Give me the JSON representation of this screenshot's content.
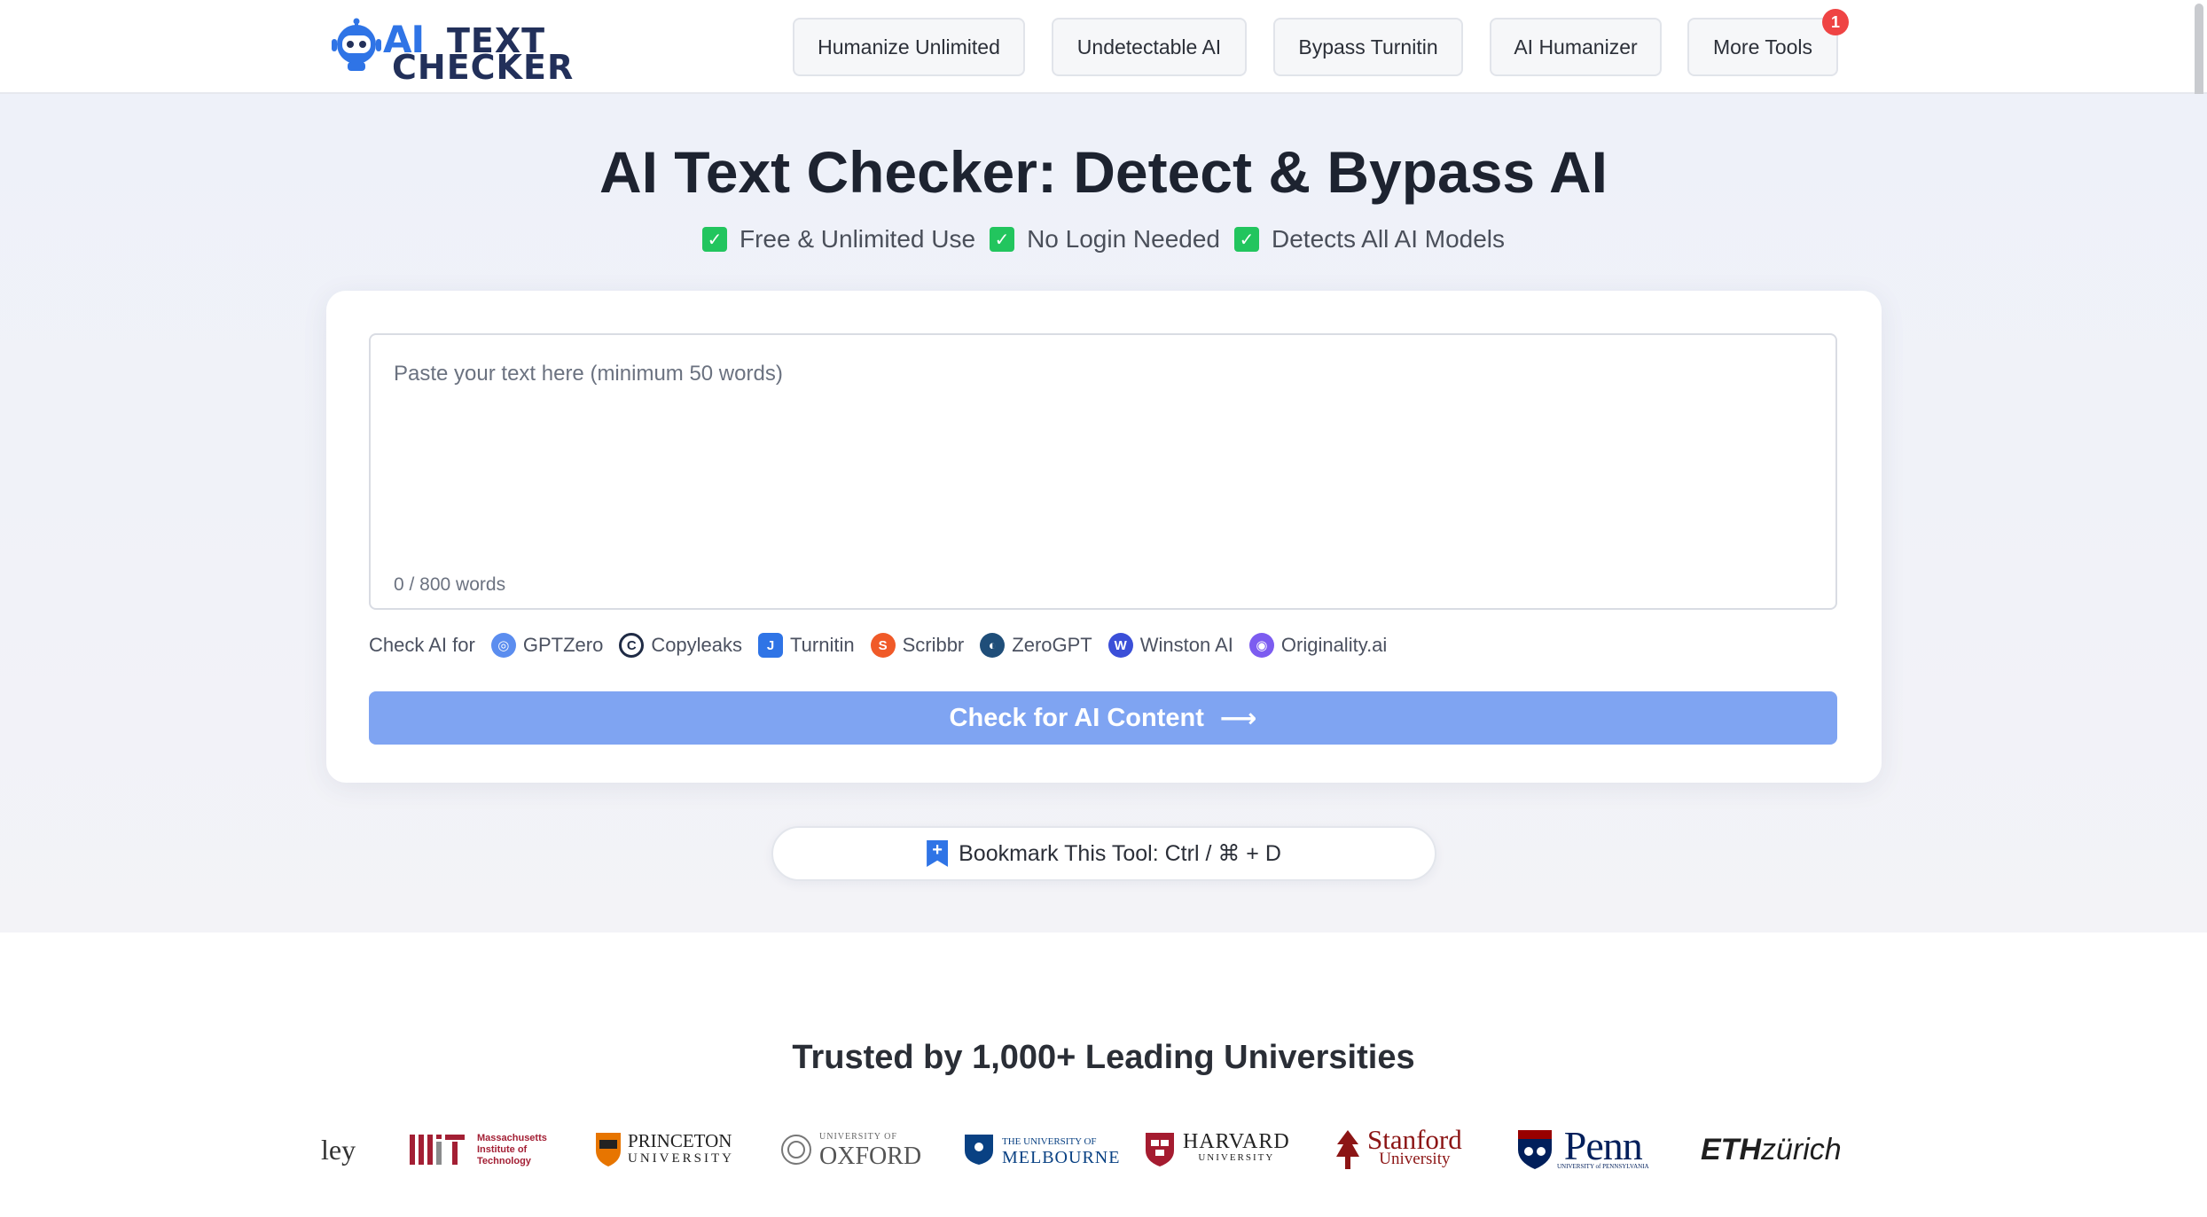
{
  "header": {
    "logo": {
      "line_ai": "AI",
      "line_1": "TEXT",
      "line_2": "CHECKER"
    },
    "nav": [
      {
        "label": "Humanize Unlimited"
      },
      {
        "label": "Undetectable AI"
      },
      {
        "label": "Bypass Turnitin"
      },
      {
        "label": "AI Humanizer"
      },
      {
        "label": "More Tools",
        "badge": "1"
      }
    ]
  },
  "hero": {
    "title": "AI Text Checker: Detect & Bypass AI",
    "features": [
      "Free & Unlimited Use",
      "No Login Needed",
      "Detects All AI Models"
    ]
  },
  "checker": {
    "placeholder": "Paste your text here (minimum 50 words)",
    "word_count": "0 / 800 words",
    "check_for_label": "Check AI for",
    "detectors": [
      {
        "name": "GPTZero",
        "icon": "gptzero-icon",
        "color": "#5b8def"
      },
      {
        "name": "Copyleaks",
        "icon": "copyleaks-icon",
        "color": "#1f2b45"
      },
      {
        "name": "Turnitin",
        "icon": "turnitin-icon",
        "color": "#2f74e6"
      },
      {
        "name": "Scribbr",
        "icon": "scribbr-icon",
        "color": "#f05a28"
      },
      {
        "name": "ZeroGPT",
        "icon": "zerogpt-icon",
        "color": "#1f4e79"
      },
      {
        "name": "Winston AI",
        "icon": "winston-icon",
        "color": "#3b4fd8"
      },
      {
        "name": "Originality.ai",
        "icon": "originality-icon",
        "color": "#7c5cf0"
      }
    ],
    "submit_label": "Check for AI Content",
    "submit_color": "#7fa4f2"
  },
  "bookmark": {
    "label": "Bookmark This Tool: Ctrl / ⌘ + D"
  },
  "trusted": {
    "title": "Trusted by 1,000+ Leading Universities",
    "universities": [
      {
        "name": "ley",
        "note": "partially visible"
      },
      {
        "name": "MIT",
        "subtitle": "Massachusetts Institute of Technology"
      },
      {
        "name": "PRINCETON",
        "subtitle": "UNIVERSITY"
      },
      {
        "name": "OXFORD",
        "subtitle": "UNIVERSITY OF"
      },
      {
        "name": "MELBOURNE",
        "subtitle": "THE UNIVERSITY OF"
      },
      {
        "name": "HARVARD",
        "subtitle": "UNIVERSITY"
      },
      {
        "name": "Stanford",
        "subtitle": "University"
      },
      {
        "name": "Penn",
        "subtitle": "UNIVERSITY of PENNSYLVANIA"
      },
      {
        "name_bold": "ETH",
        "name": "zürich"
      }
    ]
  }
}
